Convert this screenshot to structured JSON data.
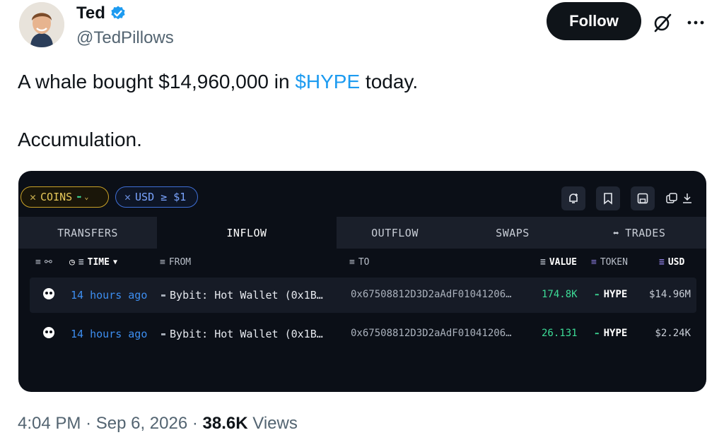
{
  "author": {
    "display_name": "Ted",
    "handle": "@TedPillows",
    "verified_icon": "verified-badge-icon"
  },
  "actions": {
    "follow_label": "Follow",
    "grok_icon": "grok-icon",
    "more_icon": "more-icon"
  },
  "tweet": {
    "text_before": "A whale bought $14,960,000 in ",
    "cashtag": "$HYPE",
    "text_after": " today.",
    "line2": "Accumulation."
  },
  "card": {
    "filters": {
      "coins_label": "COINS",
      "usd_label": "USD ≥ $1"
    },
    "toolbar_icons": [
      "alert-add-icon",
      "bookmark-icon",
      "save-icon",
      "copy-download-icon"
    ],
    "tabs": [
      {
        "label": "TRANSFERS"
      },
      {
        "label": "INFLOW"
      },
      {
        "label": "OUTFLOW"
      },
      {
        "label": "SWAPS"
      },
      {
        "label": "TRADES"
      }
    ],
    "active_tab": "INFLOW",
    "columns": {
      "time": "TIME",
      "from": "FROM",
      "to": "TO",
      "value": "VALUE",
      "token": "TOKEN",
      "usd": "USD"
    },
    "rows": [
      {
        "time": "14 hours ago",
        "from": "Bybit: Hot Wallet (0x1B…",
        "to": "0x67508812D3D2aAdF01041206…",
        "value": "174.8K",
        "token": "HYPE",
        "usd": "$14.96M"
      },
      {
        "time": "14 hours ago",
        "from": "Bybit: Hot Wallet (0x1B…",
        "to": "0x67508812D3D2aAdF01041206…",
        "value": "26.131",
        "token": "HYPE",
        "usd": "$2.24K"
      }
    ]
  },
  "footer": {
    "time": "4:04 PM",
    "date": "Sep 6, 2026",
    "views_count": "38.6K",
    "views_label": "Views"
  },
  "colors": {
    "accent": "#1d9bf0",
    "card_bg": "#0b0f17",
    "positive": "#3ddc97"
  }
}
